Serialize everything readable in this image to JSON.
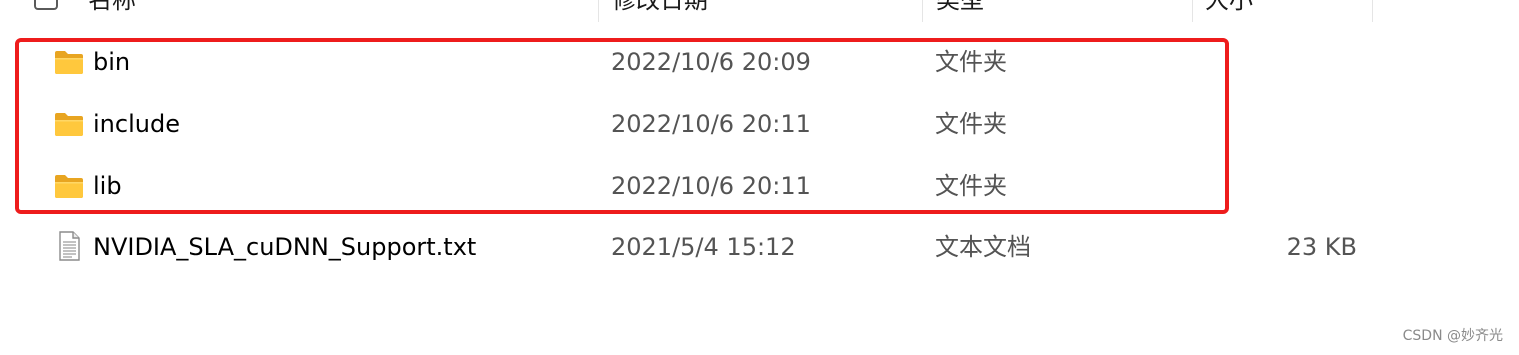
{
  "header": {
    "columns": {
      "name": "名称",
      "date": "修改日期",
      "type": "类型",
      "size": "大小"
    }
  },
  "files": [
    {
      "name": "bin",
      "date": "2022/10/6 20:09",
      "type": "文件夹",
      "size": "",
      "icon": "folder-icon"
    },
    {
      "name": "include",
      "date": "2022/10/6 20:11",
      "type": "文件夹",
      "size": "",
      "icon": "folder-icon"
    },
    {
      "name": "lib",
      "date": "2022/10/6 20:11",
      "type": "文件夹",
      "size": "",
      "icon": "folder-icon"
    },
    {
      "name": "NVIDIA_SLA_cuDNN_Support.txt",
      "date": "2021/5/4 15:12",
      "type": "文本文档",
      "size": "23 KB",
      "icon": "text-file-icon"
    }
  ],
  "highlight": {
    "color": "#ee1c1c"
  },
  "watermark": "CSDN @妙齐光"
}
